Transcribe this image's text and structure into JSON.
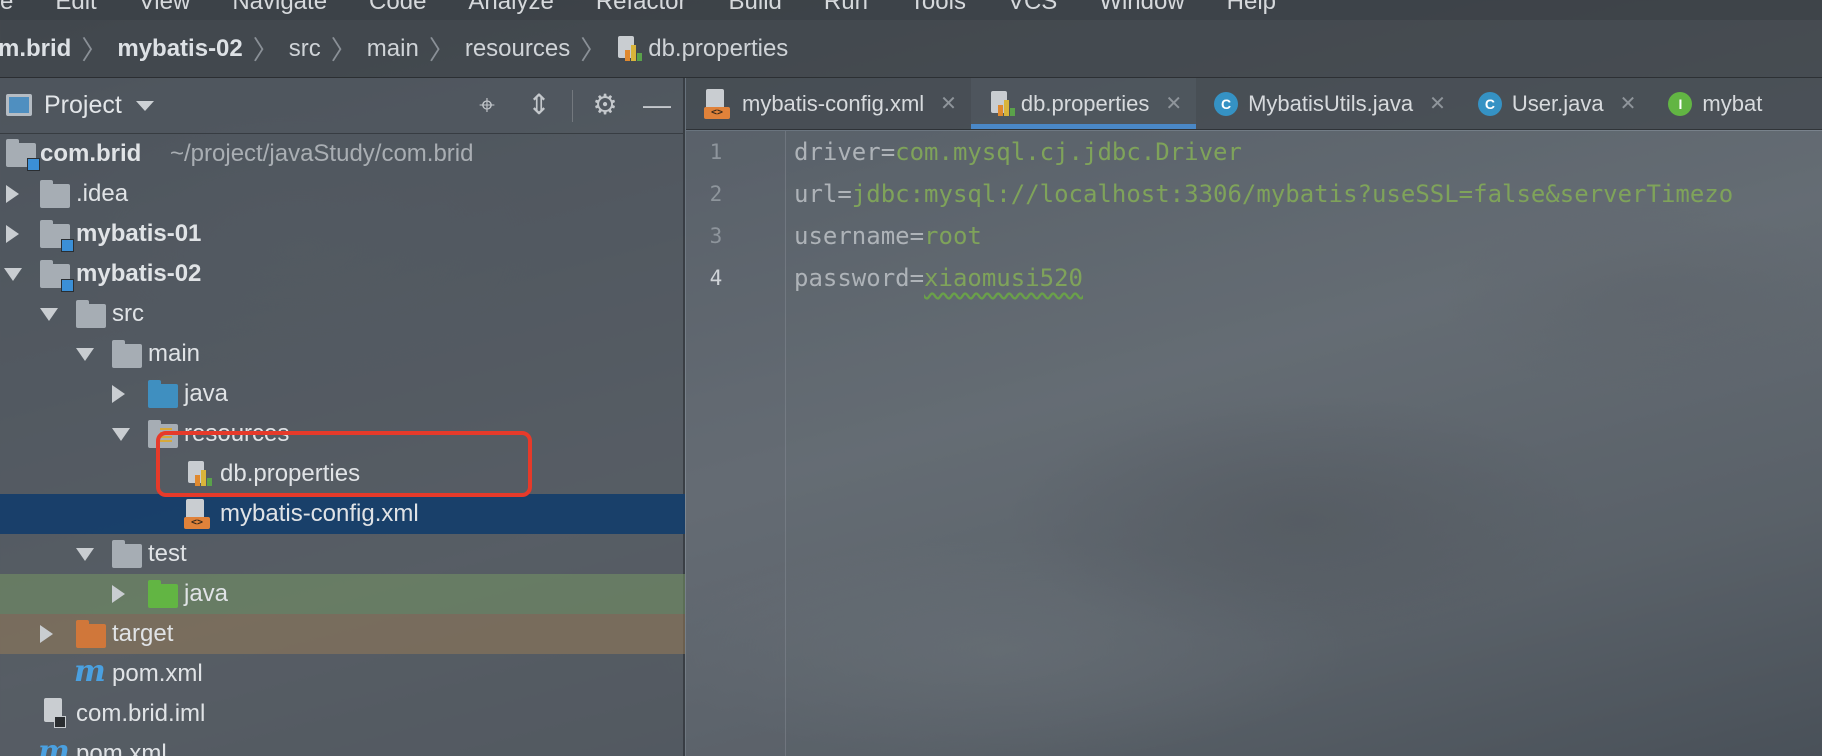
{
  "menu": [
    "e",
    "Edit",
    "View",
    "Navigate",
    "Code",
    "Analyze",
    "Refactor",
    "Build",
    "Run",
    "Tools",
    "VCS",
    "Window",
    "Help"
  ],
  "breadcrumb": [
    "m.brid",
    "mybatis-02",
    "src",
    "main",
    "resources",
    "db.properties"
  ],
  "project_panel": {
    "title": "Project",
    "tree": [
      {
        "label": "com.brid",
        "extra": "~/project/javaStudy/com.brid"
      },
      {
        "label": ".idea"
      },
      {
        "label": "mybatis-01"
      },
      {
        "label": "mybatis-02"
      },
      {
        "label": "src"
      },
      {
        "label": "main"
      },
      {
        "label": "java"
      },
      {
        "label": "resources"
      },
      {
        "label": "db.properties"
      },
      {
        "label": "mybatis-config.xml"
      },
      {
        "label": "test"
      },
      {
        "label": "java"
      },
      {
        "label": "target"
      },
      {
        "label": "pom.xml"
      },
      {
        "label": "com.brid.iml"
      },
      {
        "label": "pom.xml"
      }
    ]
  },
  "tabs": [
    {
      "label": "mybatis-config.xml",
      "icon": "xml-file-icon"
    },
    {
      "label": "db.properties",
      "icon": "properties-file-icon",
      "active": true
    },
    {
      "label": "MybatisUtils.java",
      "icon": "class-icon",
      "icon_letter": "C"
    },
    {
      "label": "User.java",
      "icon": "class-icon",
      "icon_letter": "C"
    },
    {
      "label": "mybat",
      "icon": "interface-icon",
      "icon_letter": "I"
    }
  ],
  "editor": {
    "lines": [
      {
        "num": "1",
        "key": "driver=",
        "value": "com.mysql.cj.jdbc.Driver"
      },
      {
        "num": "2",
        "key": "url=",
        "value": "jdbc:mysql://localhost:3306/mybatis?useSSL=false&serverTimezo"
      },
      {
        "num": "3",
        "key": "username=",
        "value": "root"
      },
      {
        "num": "4",
        "key": "password=",
        "value": "xiaomusi520"
      }
    ]
  },
  "colors": {
    "selection": "#163e6a",
    "highlight_box": "#e63a2a",
    "active_tab_underline": "#4a88c7",
    "property_value": "#7fa35a"
  }
}
